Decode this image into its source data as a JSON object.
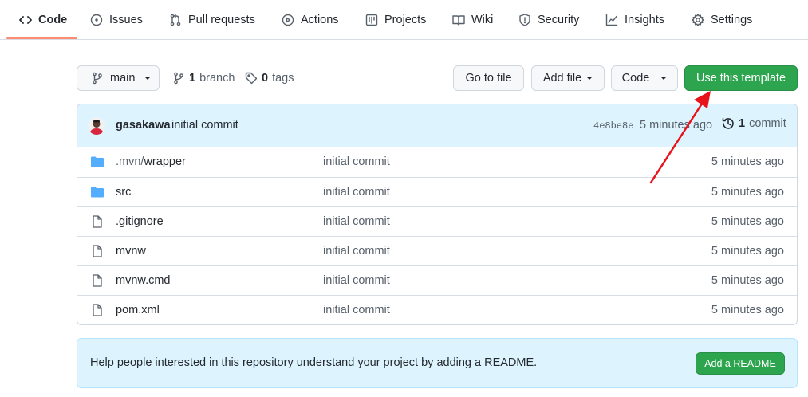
{
  "nav": {
    "tabs": [
      {
        "label": "Code",
        "icon": "code-icon"
      },
      {
        "label": "Issues",
        "icon": "issue-icon"
      },
      {
        "label": "Pull requests",
        "icon": "pull-request-icon"
      },
      {
        "label": "Actions",
        "icon": "play-icon"
      },
      {
        "label": "Projects",
        "icon": "project-icon"
      },
      {
        "label": "Wiki",
        "icon": "book-icon"
      },
      {
        "label": "Security",
        "icon": "shield-icon"
      },
      {
        "label": "Insights",
        "icon": "graph-icon"
      },
      {
        "label": "Settings",
        "icon": "gear-icon"
      }
    ],
    "active_tab": "Code",
    "accent_color": "#fd8c73"
  },
  "toolbar": {
    "branch_selector": "main",
    "branch_count": "1",
    "branch_label": "branch",
    "tag_count": "0",
    "tag_label": "tags",
    "go_to_file": "Go to file",
    "add_file": "Add file",
    "code": "Code",
    "use_template": "Use this template",
    "primary_color": "#2da44e"
  },
  "latest_commit": {
    "author": "gasakawa",
    "message": "initial commit",
    "sha": "4e8be8e",
    "time": "5 minutes ago",
    "commit_count": "1",
    "commit_label": "commit"
  },
  "files": [
    {
      "type": "folder",
      "name_dim": ".mvn/",
      "name": "wrapper",
      "commit": "initial commit",
      "time": "5 minutes ago"
    },
    {
      "type": "folder",
      "name_dim": "",
      "name": "src",
      "commit": "initial commit",
      "time": "5 minutes ago"
    },
    {
      "type": "file",
      "name_dim": "",
      "name": ".gitignore",
      "commit": "initial commit",
      "time": "5 minutes ago"
    },
    {
      "type": "file",
      "name_dim": "",
      "name": "mvnw",
      "commit": "initial commit",
      "time": "5 minutes ago"
    },
    {
      "type": "file",
      "name_dim": "",
      "name": "mvnw.cmd",
      "commit": "initial commit",
      "time": "5 minutes ago"
    },
    {
      "type": "file",
      "name_dim": "",
      "name": "pom.xml",
      "commit": "initial commit",
      "time": "5 minutes ago"
    }
  ],
  "readme_banner": {
    "text": "Help people interested in this repository understand your project by adding a README.",
    "button": "Add a README"
  },
  "annotation": {
    "arrow_color": "#e8141b"
  }
}
